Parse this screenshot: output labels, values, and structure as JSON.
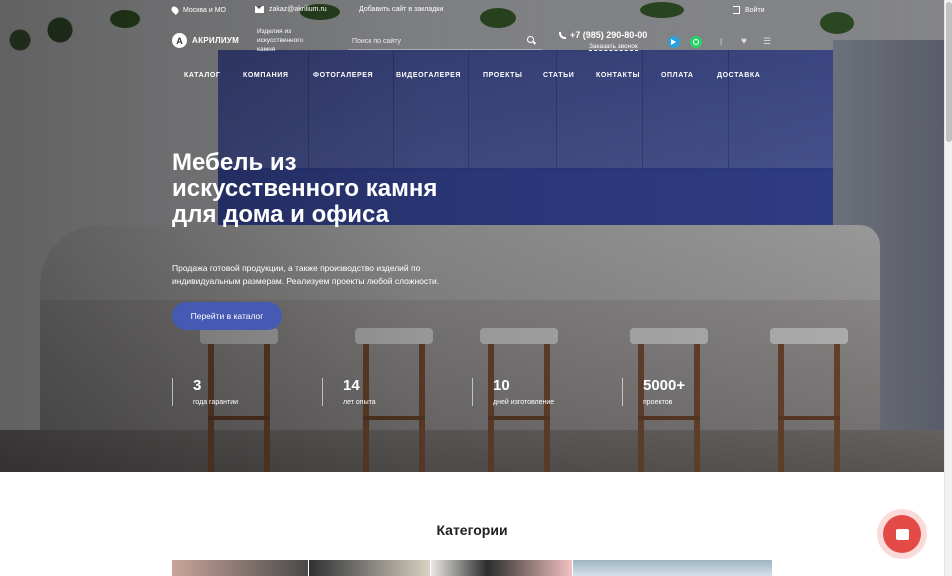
{
  "topbar": {
    "city": "Москва и МО",
    "email": "zakaz@akrilium.ru",
    "bookmark": "Добавить сайт в закладки",
    "login": "Войти"
  },
  "header": {
    "logo": "АКРИЛИУМ",
    "logo_letter": "A",
    "tagline": "Изделия из искусственного камня",
    "search_placeholder": "Поиск по сайту",
    "phone": "+7 (985) 290-80-00",
    "callback": "Заказать звонок",
    "divider": "|"
  },
  "nav": [
    "КАТАЛОГ",
    "КОМПАНИЯ",
    "ФОТОГАЛЕРЕЯ",
    "ВИДЕОГАЛЕРЕЯ",
    "ПРОЕКТЫ",
    "СТАТЬИ",
    "КОНТАКТЫ",
    "ОПЛАТА",
    "ДОСТАВКА"
  ],
  "hero": {
    "title": "Мебель из искусственного камня для дома и офиса",
    "lead": "Продажа готовой продукции, а также производство изделий по индивидуальным размерам. Реализуем проекты любой сложности.",
    "cta": "Перейти в каталог"
  },
  "stats": [
    {
      "num": "3",
      "label": "года гарантии"
    },
    {
      "num": "14",
      "label": "лет опыта"
    },
    {
      "num": "10",
      "label": "дней изготовление"
    },
    {
      "num": "5000+",
      "label": "проектов"
    }
  ],
  "categories": {
    "title": "Категории"
  },
  "colors": {
    "accent": "#4659b3",
    "chat": "#e44b46",
    "telegram": "#2aa1da",
    "whatsapp": "#25d366"
  }
}
